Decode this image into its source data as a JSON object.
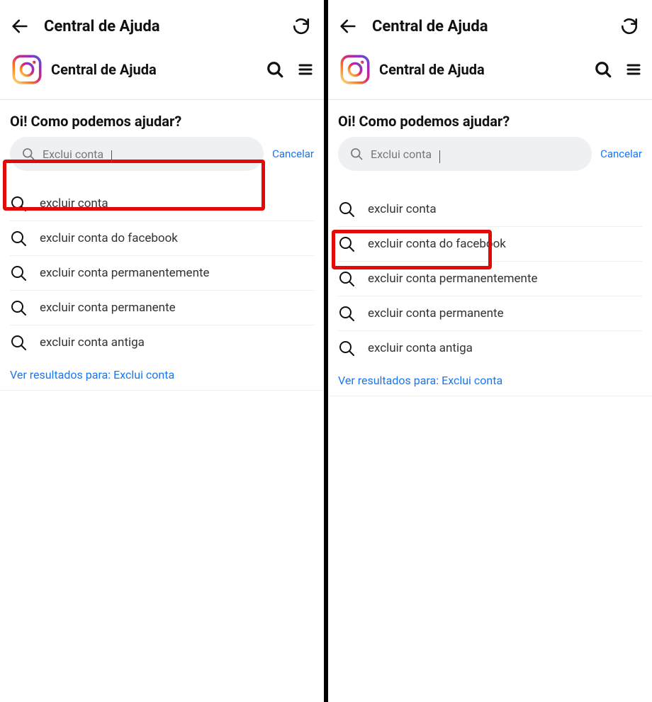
{
  "topbar": {
    "title": "Central de Ajuda"
  },
  "brandbar": {
    "title": "Central de Ajuda"
  },
  "help_heading": "Oi! Como podemos ajudar?",
  "search": {
    "query": "Exclui conta",
    "cancel": "Cancelar"
  },
  "suggestions": [
    "excluir conta",
    "excluir conta do facebook",
    "excluir conta permanentemente",
    "excluir conta permanente",
    "excluir conta antiga"
  ],
  "see_results_prefix": "Ver resultados para: ",
  "see_results_term": "Exclui conta",
  "left_pane_highlight": "search-bar",
  "right_pane_highlight": "first-suggestion"
}
